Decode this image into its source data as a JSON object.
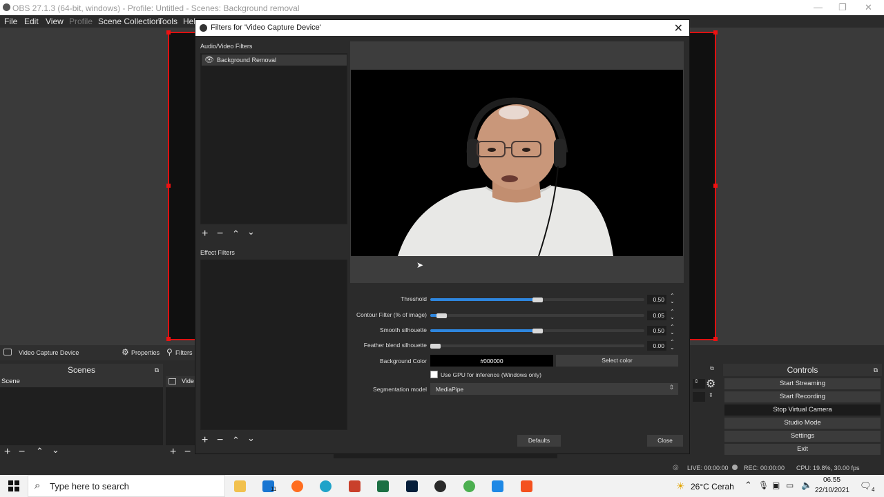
{
  "window": {
    "title": "OBS 27.1.3 (64-bit, windows) - Profile: Untitled - Scenes: Background removal"
  },
  "menu": [
    "File",
    "Edit",
    "View",
    "Profile",
    "Scene Collection",
    "Tools",
    "Help"
  ],
  "source_bar": {
    "source_name": "Video Capture Device",
    "properties_label": "Properties",
    "filters_label": "Filters"
  },
  "docks": {
    "scenes_title": "Scenes",
    "scene_item": "Scene",
    "sources_item": "Vide",
    "controls_title": "Controls"
  },
  "controls": [
    "Start Streaming",
    "Start Recording",
    "Stop Virtual Camera",
    "Studio Mode",
    "Settings",
    "Exit"
  ],
  "status": {
    "live": "LIVE: 00:00:00",
    "rec": "REC: 00:00:00",
    "cpu": "CPU: 19.8%, 30.00 fps"
  },
  "dialog": {
    "title": "Filters for 'Video Capture Device'",
    "av_filters_label": "Audio/Video Filters",
    "av_filter_item": "Background Removal",
    "effect_filters_label": "Effect Filters",
    "properties": [
      {
        "label": "Threshold",
        "value": "0.50",
        "fraction": 0.5
      },
      {
        "label": "Contour Filter (% of image)",
        "value": "0.05",
        "fraction": 0.05
      },
      {
        "label": "Smooth silhouette",
        "value": "0.50",
        "fraction": 0.5
      },
      {
        "label": "Feather blend silhouette",
        "value": "0.00",
        "fraction": 0.0
      }
    ],
    "background_color_label": "Background Color",
    "background_color_value": "#000000",
    "select_color_label": "Select color",
    "gpu_checkbox_label": "Use GPU for inference (Windows only)",
    "gpu_checked": false,
    "segmentation_label": "Segmentation model",
    "segmentation_value": "MediaPipe",
    "defaults_label": "Defaults",
    "close_label": "Close"
  },
  "taskbar": {
    "search_placeholder": "Type here to search",
    "weather": "26°C  Cerah",
    "time": "06.55",
    "date": "22/10/2021",
    "notification_count": "4",
    "mail_badge": "11"
  },
  "colors": {
    "accent": "#2e86de",
    "canvas_border": "#dd1111"
  }
}
